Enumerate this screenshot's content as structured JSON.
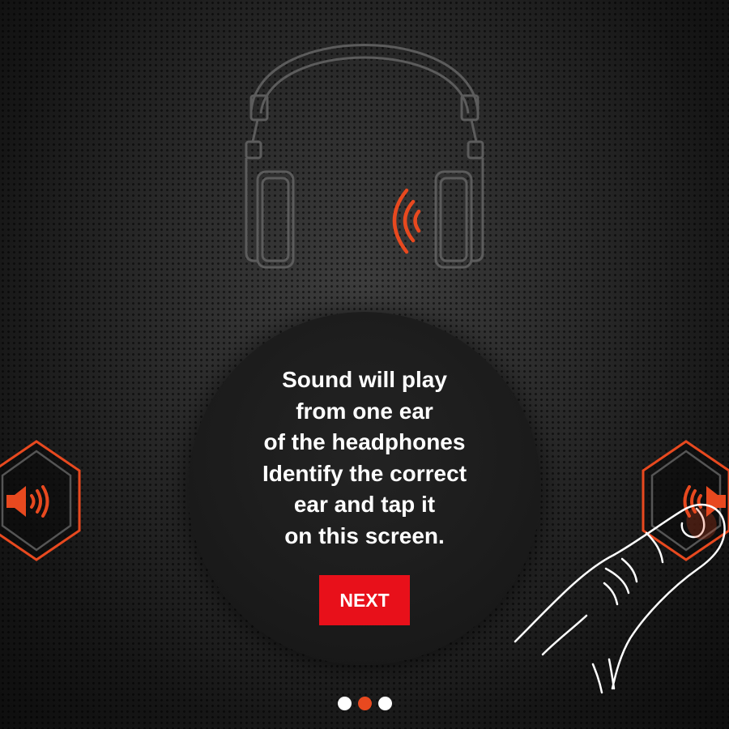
{
  "instructions": {
    "lines": [
      "Sound will play",
      "from one ear",
      "of the headphones",
      "Identify the correct",
      "ear and tap it",
      "on this screen."
    ]
  },
  "next_button": {
    "label": "NEXT"
  },
  "icons": {
    "headphones": "headphones-icon",
    "sound_waves": "sound-waves-icon",
    "left_ear": "speaker-volume-icon",
    "right_ear": "speaker-volume-icon",
    "hand": "tapping-finger-icon"
  },
  "pagination": {
    "total": 3,
    "current": 2
  },
  "colors": {
    "accent": "#e8491f",
    "button": "#e8101a",
    "text": "#ffffff",
    "background": "#1a1a1a"
  }
}
